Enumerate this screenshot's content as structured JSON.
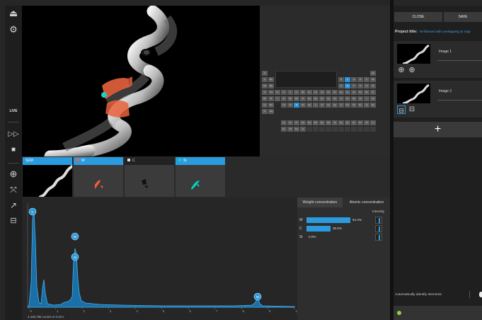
{
  "toolbar": {
    "live_label": "LIVE"
  },
  "thumbnails": [
    {
      "label": "SEM",
      "color": "#2b9be0"
    },
    {
      "label": "W",
      "color": "#ff5a36"
    },
    {
      "label": "C",
      "color": "#eeeeee"
    },
    {
      "label": "Si",
      "color": "#00d6c0"
    }
  ],
  "periodic_table": {
    "selected": [
      "C",
      "Si",
      "W"
    ]
  },
  "spectrum": {
    "peaks": [
      "C",
      "W",
      "Si",
      "W"
    ],
    "x_ticks": [
      "0",
      "1",
      "2",
      "3",
      "4",
      "5",
      "6",
      "7",
      "8",
      "9",
      "10"
    ],
    "counts_label": "4,428,786 counts in 0.03 s"
  },
  "concentration": {
    "tabs": [
      "Weight concentration",
      "Atomic concentration"
    ],
    "intensity_label": "Intensity",
    "rows": [
      {
        "element": "W",
        "value": "64.4%",
        "fraction": 0.644
      },
      {
        "element": "C",
        "value": "35.6%",
        "fraction": 0.356
      },
      {
        "element": "Si",
        "value": "0.0%",
        "fraction": 0.0
      }
    ]
  },
  "right_panel": {
    "close_label": "CLOSE",
    "save_label": "SAVE",
    "project_title_label": "Project title:",
    "project_title_value": "W filament with overlapping Si map",
    "images": [
      {
        "label": "Image 1"
      },
      {
        "label": "Image 2"
      }
    ],
    "add_label": "+",
    "auto_identify_label": "Automatically identify elements"
  }
}
